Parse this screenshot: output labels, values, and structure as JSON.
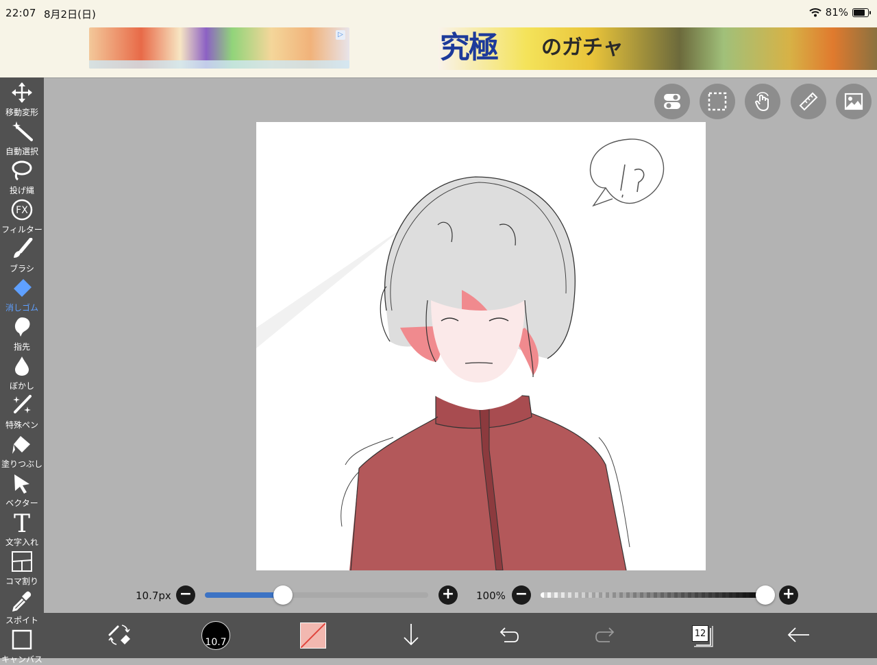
{
  "status_bar": {
    "time": "22:07",
    "date": "8月2日(日)",
    "battery_percent": "81%",
    "battery_level": 0.81
  },
  "ads": {
    "left_ad_choice": "▷",
    "right_ad_text_big": "究極",
    "right_ad_text_small": "のガチャ"
  },
  "left_toolbar": {
    "tools": [
      {
        "id": "move",
        "label": "移動変形",
        "icon": "move-arrows-icon"
      },
      {
        "id": "magic-wand",
        "label": "自動選択",
        "icon": "magic-wand-icon"
      },
      {
        "id": "lasso",
        "label": "投げ縄",
        "icon": "lasso-icon"
      },
      {
        "id": "filter",
        "label": "フィルター",
        "icon": "fx-filter-icon",
        "icon_text": "FX"
      },
      {
        "id": "brush",
        "label": "ブラシ",
        "icon": "brush-icon"
      },
      {
        "id": "eraser",
        "label": "消しゴム",
        "icon": "eraser-icon",
        "active": true
      },
      {
        "id": "finger",
        "label": "指先",
        "icon": "smudge-finger-icon"
      },
      {
        "id": "blur",
        "label": "ぼかし",
        "icon": "blur-drop-icon"
      },
      {
        "id": "special-pen",
        "label": "特殊ペン",
        "icon": "special-pen-icon"
      },
      {
        "id": "fill",
        "label": "塗りつぶし",
        "icon": "paint-bucket-icon"
      },
      {
        "id": "vector",
        "label": "ベクター",
        "icon": "vector-cursor-icon"
      },
      {
        "id": "text",
        "label": "文字入れ",
        "icon": "text-t-icon",
        "icon_text": "T"
      },
      {
        "id": "frame",
        "label": "コマ割り",
        "icon": "frame-divider-icon"
      },
      {
        "id": "eyedropper",
        "label": "スポイト",
        "icon": "eyedropper-icon"
      },
      {
        "id": "canvas",
        "label": "キャンバス",
        "icon": "canvas-square-icon"
      }
    ]
  },
  "top_buttons": [
    {
      "id": "toggle",
      "icon": "toggle-switch-icon"
    },
    {
      "id": "selection",
      "icon": "dashed-selection-icon"
    },
    {
      "id": "touch",
      "icon": "hand-touch-icon"
    },
    {
      "id": "ruler",
      "icon": "ruler-icon"
    },
    {
      "id": "material",
      "icon": "image-material-icon"
    }
  ],
  "sliders": {
    "size_label": "10.7px",
    "size_fraction": 0.35,
    "opacity_label": "100%",
    "opacity_fraction": 1.0,
    "minus": "−",
    "plus": "+"
  },
  "bottom_toolbar": {
    "brush_size": "10.7",
    "layer_count": "12",
    "swatch_color": "#f2b8b0"
  },
  "colors": {
    "toolbar_bg": "#515151",
    "active_tool": "#5fa0ff",
    "workspace_bg": "#b3b3b3",
    "size_slider_fill": "#3c73c4",
    "jacket_red": "#b3585a",
    "hair_pink": "#f08a8e"
  }
}
